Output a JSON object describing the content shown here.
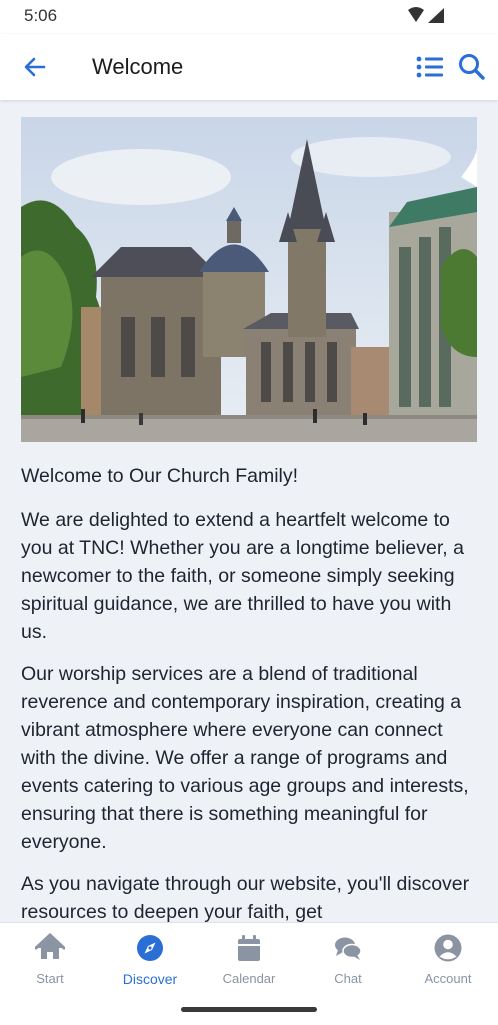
{
  "status_bar": {
    "time": "5:06"
  },
  "app_bar": {
    "title": "Welcome"
  },
  "colors": {
    "accent": "#2a6fd6",
    "background": "#eef1f6",
    "nav_inactive": "#8a94a3"
  },
  "article": {
    "heading": "Welcome to Our Church Family!",
    "paragraphs": [
      "We are delighted to extend a heartfelt welcome to you at TNC! Whether you are a longtime believer, a newcomer to the faith, or someone simply seeking spiritual guidance, we are thrilled to have you with us.",
      "Our worship services are a blend of traditional reverence and contemporary inspiration, creating a vibrant atmosphere where everyone can connect with the divine. We offer a range of programs and events catering to various age groups and interests, ensuring that there is something meaningful for everyone.",
      "As you navigate through our website, you'll discover resources to deepen your faith, get"
    ]
  },
  "bottom_nav": {
    "items": [
      {
        "label": "Start",
        "icon": "home-icon"
      },
      {
        "label": "Discover",
        "icon": "compass-icon",
        "active": true
      },
      {
        "label": "Calendar",
        "icon": "calendar-icon"
      },
      {
        "label": "Chat",
        "icon": "chat-icon"
      },
      {
        "label": "Account",
        "icon": "account-icon"
      }
    ]
  }
}
